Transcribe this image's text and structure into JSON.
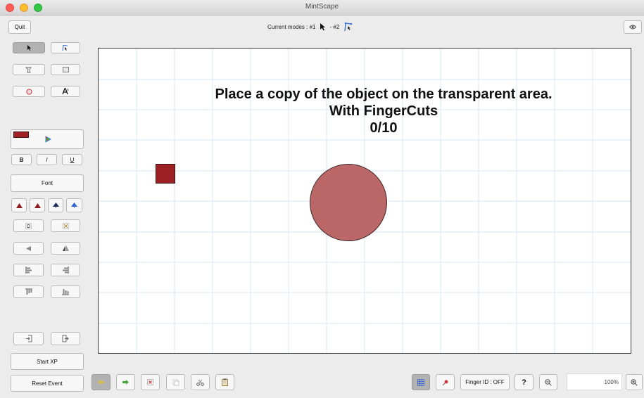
{
  "window": {
    "title": "MintScape"
  },
  "toolbar": {
    "quit_label": "Quit",
    "modes_label": "Current modes : #1",
    "modes_sep": "- #2"
  },
  "canvas": {
    "instruction_line1": "Place a copy of the object on the transparent area.",
    "instruction_line2": "With FingerCuts",
    "progress": "0/10",
    "square_color": "#9c2024",
    "circle_color": "#bb6768"
  },
  "sidebar": {
    "bold_label": "B",
    "italic_label": "I",
    "underline_label": "U",
    "font_label": "Font",
    "start_xp_label": "Start XP",
    "reset_event_label": "Reset Event",
    "selected_color": "#9c2024"
  },
  "bottombar": {
    "finger_id_label": "Finger ID : OFF",
    "help_label": "?",
    "zoom_value": "100%"
  }
}
